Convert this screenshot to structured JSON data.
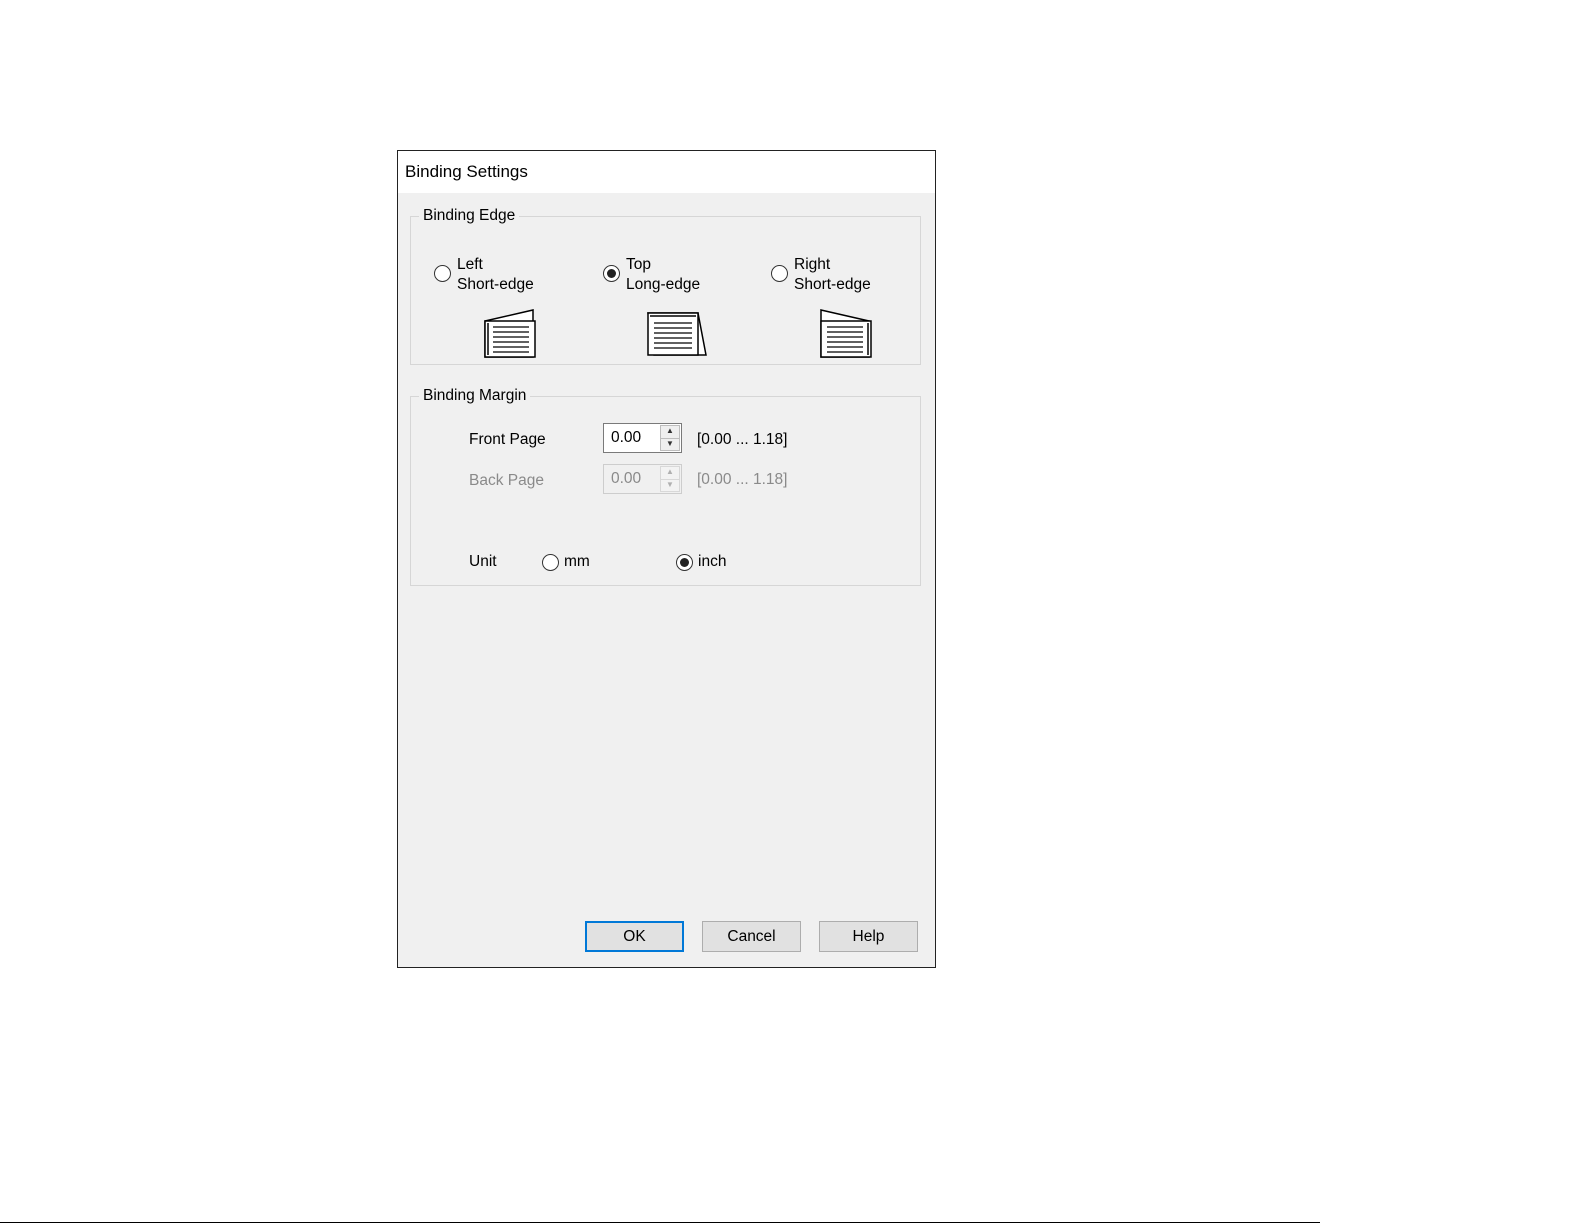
{
  "dialog": {
    "title": "Binding Settings"
  },
  "binding_edge": {
    "legend": "Binding Edge",
    "options": [
      {
        "line1": "Left",
        "line2": "Short-edge",
        "checked": false,
        "icon": "left-binding-page-icon"
      },
      {
        "line1": "Top",
        "line2": "Long-edge",
        "checked": true,
        "icon": "top-binding-page-icon"
      },
      {
        "line1": "Right",
        "line2": "Short-edge",
        "checked": false,
        "icon": "right-binding-page-icon"
      }
    ]
  },
  "binding_margin": {
    "legend": "Binding Margin",
    "front_page": {
      "label": "Front Page",
      "value": "0.00",
      "range": "[0.00 ... 1.18]",
      "enabled": true
    },
    "back_page": {
      "label": "Back Page",
      "value": "0.00",
      "range": "[0.00 ... 1.18]",
      "enabled": false
    },
    "unit": {
      "label": "Unit",
      "options": [
        {
          "label": "mm",
          "checked": false
        },
        {
          "label": "inch",
          "checked": true
        }
      ]
    }
  },
  "buttons": {
    "ok": "OK",
    "cancel": "Cancel",
    "help": "Help"
  },
  "colors": {
    "focus_border": "#0078d7",
    "dialog_bg": "#f0f0f0"
  }
}
